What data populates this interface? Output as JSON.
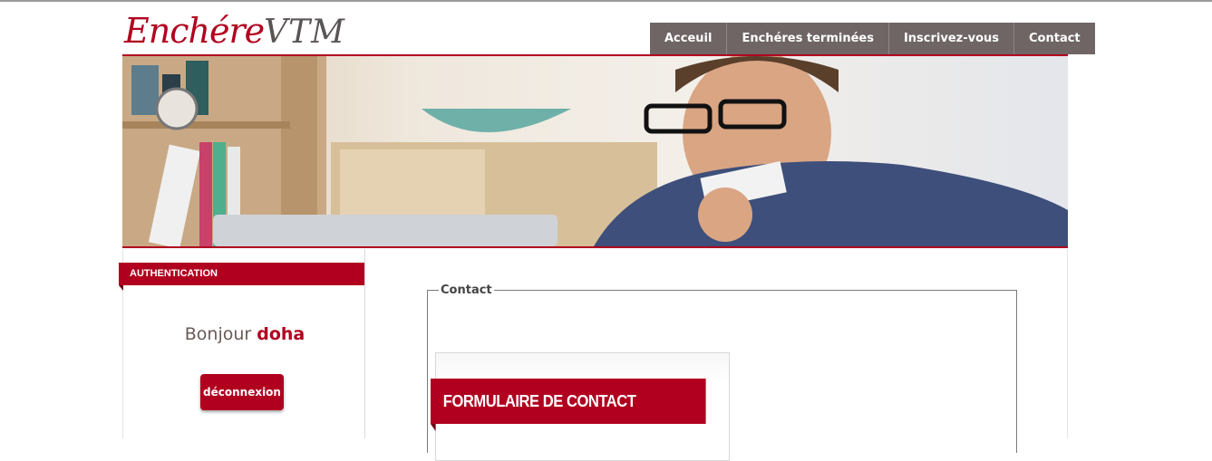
{
  "logo": {
    "part1": "Enchére",
    "part2": "VTM"
  },
  "nav": [
    {
      "label": "Acceuil"
    },
    {
      "label": "Enchéres terminées"
    },
    {
      "label": "Inscrivez-vous"
    },
    {
      "label": "Contact"
    }
  ],
  "colors": {
    "accent": "#b1001f",
    "nav_bg": "#6f6565"
  },
  "sidebar": {
    "title": "AUTHENTICATION",
    "greeting": "Bonjour",
    "username": "doha",
    "logout_label": "déconnexion"
  },
  "main": {
    "legend": "Contact",
    "form_title": "FORMULAIRE DE CONTACT"
  }
}
